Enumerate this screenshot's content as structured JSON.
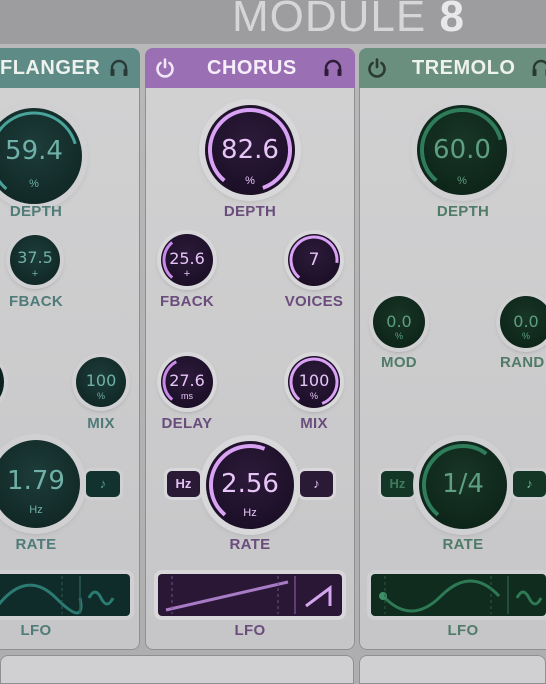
{
  "module_title": {
    "word": "MODULE",
    "number": "8"
  },
  "panels": {
    "flanger": {
      "name": "FLANGER",
      "depth": {
        "value": "59.4",
        "unit": "%",
        "label": "DEPTH"
      },
      "fback": {
        "value": "37.5",
        "unit": "+",
        "label": "FBACK"
      },
      "mix": {
        "value": "100",
        "unit": "%",
        "label": "MIX"
      },
      "rate": {
        "value": "1.79",
        "unit": "Hz",
        "label": "RATE"
      },
      "lfo_label": "LFO"
    },
    "chorus": {
      "name": "CHORUS",
      "depth": {
        "value": "82.6",
        "unit": "%",
        "label": "DEPTH"
      },
      "fback": {
        "value": "25.6",
        "unit": "+",
        "label": "FBACK"
      },
      "voices": {
        "value": "7",
        "label": "VOICES"
      },
      "delay": {
        "value": "27.6",
        "unit": "ms",
        "label": "DELAY"
      },
      "mix": {
        "value": "100",
        "unit": "%",
        "label": "MIX"
      },
      "rate": {
        "value": "2.56",
        "unit": "Hz",
        "label": "RATE"
      },
      "hz_button": "Hz",
      "lfo_label": "LFO"
    },
    "tremolo": {
      "name": "TREMOLO",
      "depth": {
        "value": "60.0",
        "unit": "%",
        "label": "DEPTH"
      },
      "mod": {
        "value": "0.0",
        "unit": "%",
        "label": "MOD"
      },
      "rand": {
        "value": "0.0",
        "unit": "%",
        "label": "RAND"
      },
      "rate": {
        "value": "1/4",
        "label": "RATE"
      },
      "hz_button": "Hz",
      "lfo_label": "LFO"
    }
  },
  "colors": {
    "teal": "#3f7c74",
    "purple": "#a36fc2",
    "green": "#2f6b52",
    "label_teal": "#4f7b78",
    "label_purple": "#6a4d7c",
    "label_green": "#4f7b68"
  }
}
